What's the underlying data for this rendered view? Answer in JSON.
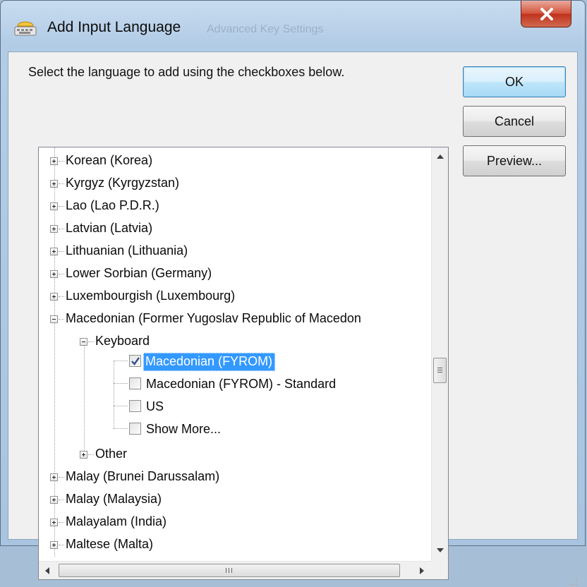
{
  "window": {
    "title": "Add Input Language",
    "title_ghost": "Advanced Key Settings",
    "icons": {
      "app": "keyboard-language-icon",
      "close": "close-icon"
    }
  },
  "instruction": "Select the language to add using the checkboxes below.",
  "buttons": {
    "ok": "OK",
    "cancel": "Cancel",
    "preview": "Preview..."
  },
  "tree": {
    "items": [
      {
        "label": "Korean (Korea)",
        "state": "collapsed"
      },
      {
        "label": "Kyrgyz (Kyrgyzstan)",
        "state": "collapsed"
      },
      {
        "label": "Lao (Lao P.D.R.)",
        "state": "collapsed"
      },
      {
        "label": "Latvian (Latvia)",
        "state": "collapsed"
      },
      {
        "label": "Lithuanian (Lithuania)",
        "state": "collapsed"
      },
      {
        "label": "Lower Sorbian (Germany)",
        "state": "collapsed"
      },
      {
        "label": "Luxembourgish (Luxembourg)",
        "state": "collapsed"
      },
      {
        "label": "Macedonian (Former Yugoslav Republic of Macedon",
        "state": "expanded"
      },
      {
        "label": "Keyboard",
        "state": "expanded"
      },
      {
        "label": "Macedonian (FYROM)",
        "checked": true,
        "selected": true
      },
      {
        "label": "Macedonian (FYROM) - Standard",
        "checked": false
      },
      {
        "label": "US",
        "checked": false
      },
      {
        "label": "Show More...",
        "checked": false
      },
      {
        "label": "Other",
        "state": "collapsed"
      },
      {
        "label": "Malay (Brunei Darussalam)",
        "state": "collapsed"
      },
      {
        "label": "Malay (Malaysia)",
        "state": "collapsed"
      },
      {
        "label": "Malayalam (India)",
        "state": "collapsed"
      },
      {
        "label": "Maltese (Malta)",
        "state": "collapsed"
      }
    ]
  },
  "scrollbars": {
    "vertical_position": 0.52,
    "horizontal_thumb_label": "III"
  },
  "colors": {
    "selection": "#3399ff",
    "close_button": "#c7402a",
    "title_bar": "#b9d1ea"
  }
}
